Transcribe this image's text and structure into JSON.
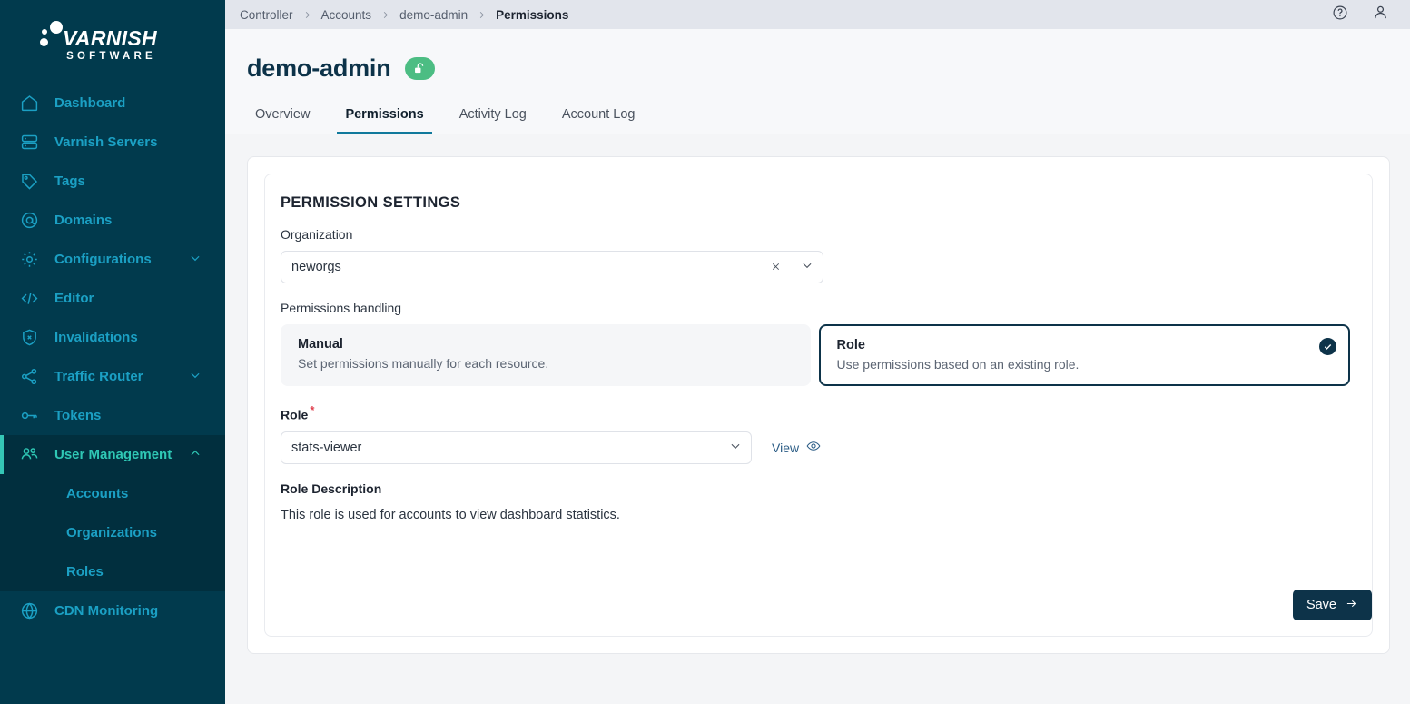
{
  "brand": {
    "name": "VARNISH",
    "tagline": "SOFTWARE",
    "sidebar_bg": "#013a4d",
    "accent": "#35c7b6",
    "link": "#1ba0c4"
  },
  "sidebar": {
    "items": [
      {
        "label": "Dashboard",
        "icon": "home-icon",
        "expandable": false,
        "active": false
      },
      {
        "label": "Varnish Servers",
        "icon": "server-icon",
        "expandable": false,
        "active": false
      },
      {
        "label": "Tags",
        "icon": "tag-icon",
        "expandable": false,
        "active": false
      },
      {
        "label": "Domains",
        "icon": "at-icon",
        "expandable": false,
        "active": false
      },
      {
        "label": "Configurations",
        "icon": "gear-icon",
        "expandable": true,
        "expanded": false,
        "active": false
      },
      {
        "label": "Editor",
        "icon": "code-icon",
        "expandable": false,
        "active": false
      },
      {
        "label": "Invalidations",
        "icon": "shield-x-icon",
        "expandable": false,
        "active": false
      },
      {
        "label": "Traffic Router",
        "icon": "share-nodes-icon",
        "expandable": true,
        "expanded": false,
        "active": false
      },
      {
        "label": "Tokens",
        "icon": "key-icon",
        "expandable": false,
        "active": false
      },
      {
        "label": "User Management",
        "icon": "users-icon",
        "expandable": true,
        "expanded": true,
        "active": true,
        "children": [
          {
            "label": "Accounts"
          },
          {
            "label": "Organizations"
          },
          {
            "label": "Roles"
          }
        ]
      },
      {
        "label": "CDN Monitoring",
        "icon": "globe-icon",
        "expandable": false,
        "active": false
      }
    ]
  },
  "topbar": {
    "breadcrumb": [
      {
        "label": "Controller",
        "current": false
      },
      {
        "label": "Accounts",
        "current": false
      },
      {
        "label": "demo-admin",
        "current": false
      },
      {
        "label": "Permissions",
        "current": true
      }
    ],
    "help_icon": "help-circle-icon",
    "user_icon": "user-avatar-icon"
  },
  "page": {
    "title": "demo-admin",
    "status_badge_icon": "unlocked-padlock-icon",
    "status_badge_color": "#4cbd83",
    "tabs": [
      {
        "label": "Overview",
        "active": false
      },
      {
        "label": "Permissions",
        "active": true
      },
      {
        "label": "Activity Log",
        "active": false
      },
      {
        "label": "Account Log",
        "active": false
      }
    ]
  },
  "form": {
    "section_title": "PERMISSION SETTINGS",
    "organization": {
      "label": "Organization",
      "value": "neworgs",
      "clear_icon": "close-x-icon",
      "chevron_icon": "chevron-down-icon"
    },
    "permissions_handling": {
      "label": "Permissions handling",
      "options": [
        {
          "title": "Manual",
          "description": "Set permissions manually for each resource.",
          "selected": false
        },
        {
          "title": "Role",
          "description": "Use permissions based on an existing role.",
          "selected": true,
          "check_icon": "check-circle-icon"
        }
      ]
    },
    "role": {
      "label": "Role",
      "required_marker": "*",
      "value": "stats-viewer",
      "chevron_icon": "chevron-down-icon",
      "view_label": "View",
      "view_icon": "eye-icon"
    },
    "role_description": {
      "label": "Role Description",
      "text": "This role is used for accounts to view dashboard statistics."
    },
    "save_label": "Save",
    "save_icon": "arrow-right-icon"
  }
}
